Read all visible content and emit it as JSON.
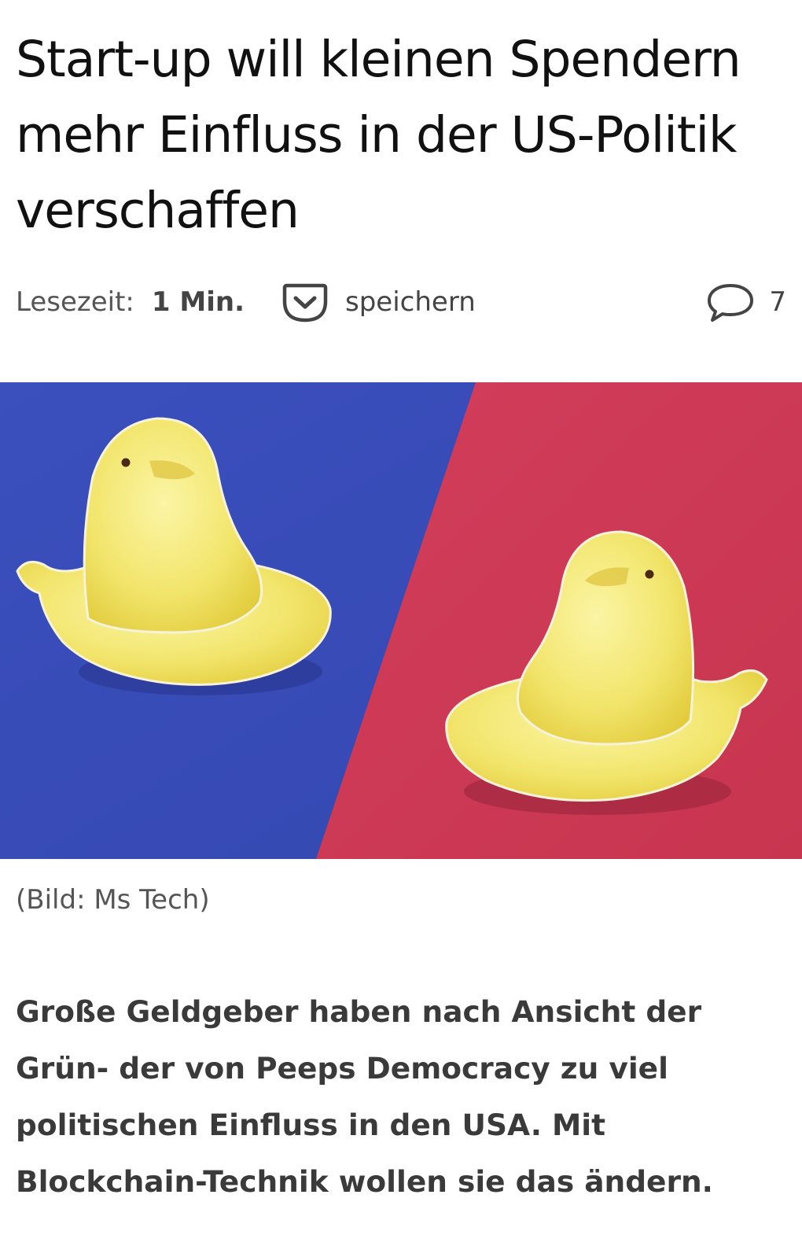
{
  "article": {
    "headline": "Start-up will kleinen Spendern mehr Einfluss in der US-Politik verschaffen",
    "meta": {
      "reading_time_label": "Lesezeit:",
      "reading_time_value": "1 Min.",
      "save_label": "speichern",
      "save_icon": "pocket-save-icon",
      "comment_icon": "comment-bubble-icon",
      "comment_count": "7"
    },
    "image": {
      "caption": "(Bild: Ms Tech)",
      "left_background": "#3a4db8",
      "right_background": "#cf3b56",
      "subject_color": "#f3e66a"
    },
    "lead": "Große Geldgeber haben nach Ansicht der Grün- der von Peeps Democracy zu viel politischen Einfluss in den USA. Mit Blockchain-Technik wollen sie das ändern."
  }
}
